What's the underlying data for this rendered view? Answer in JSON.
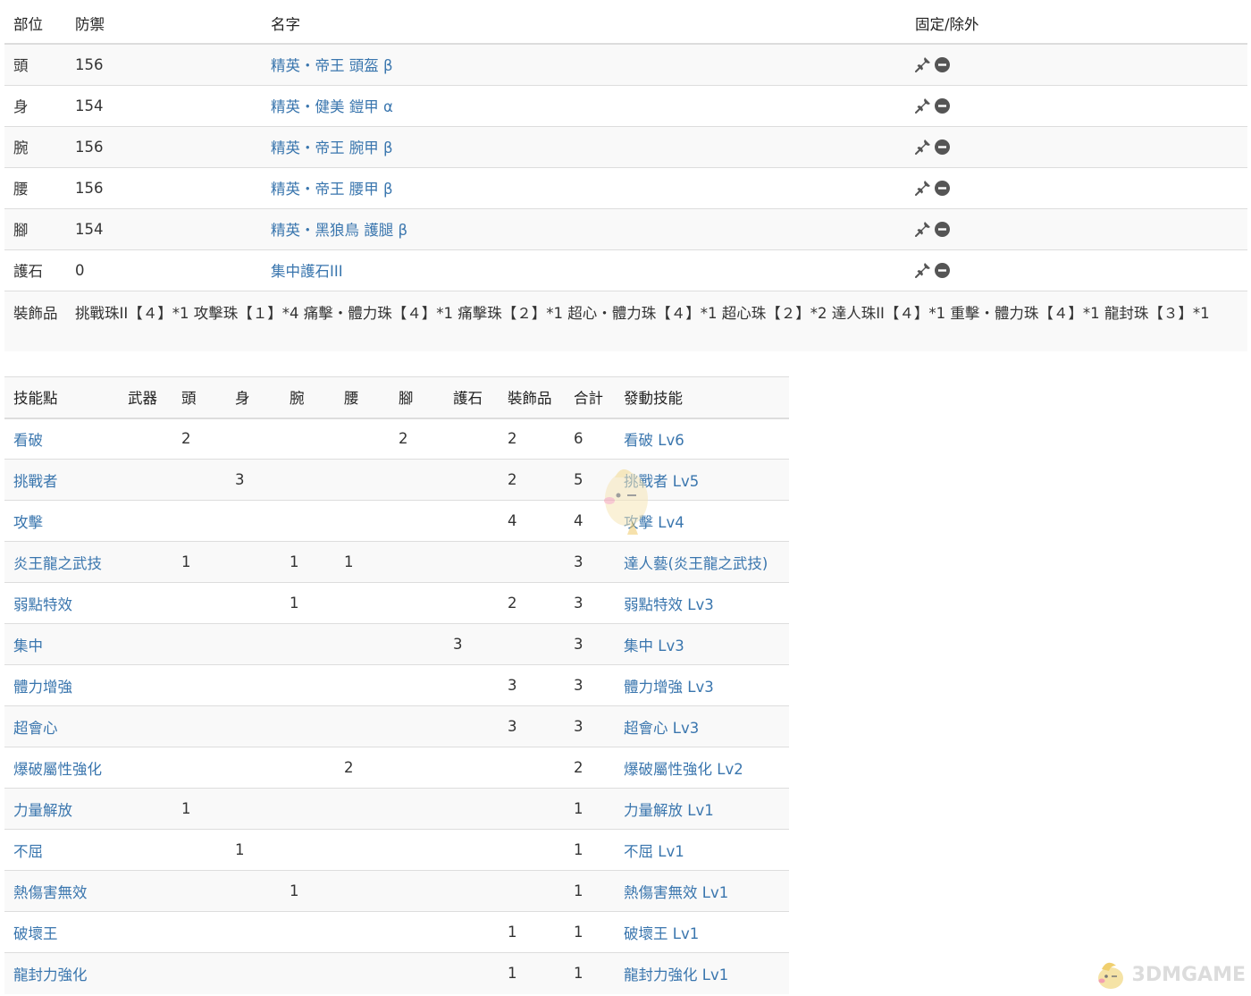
{
  "armor": {
    "headers": {
      "part": "部位",
      "defense": "防禦",
      "name": "名字",
      "actions": "固定/除外"
    },
    "rows": [
      {
        "part": "頭",
        "defense": "156",
        "name": "精英・帝王 頭盔 β"
      },
      {
        "part": "身",
        "defense": "154",
        "name": "精英・健美 鎧甲 α"
      },
      {
        "part": "腕",
        "defense": "156",
        "name": "精英・帝王 腕甲 β"
      },
      {
        "part": "腰",
        "defense": "156",
        "name": "精英・帝王 腰甲 β"
      },
      {
        "part": "腳",
        "defense": "154",
        "name": "精英・黑狼鳥 護腿 β"
      },
      {
        "part": "護石",
        "defense": "0",
        "name": "集中護石III"
      }
    ],
    "decoration": {
      "label": "裝飾品",
      "text": "挑戰珠II【４】*1 攻擊珠【１】*4 痛擊・體力珠【４】*1 痛擊珠【２】*1 超心・體力珠【４】*1 超心珠【２】*2 達人珠II【４】*1 重擊・體力珠【４】*1 龍封珠【３】*1"
    },
    "icons": {
      "fix": "pin-icon",
      "exclude": "minus-circle-icon"
    }
  },
  "skills": {
    "headers": [
      "技能點",
      "武器",
      "頭",
      "身",
      "腕",
      "腰",
      "腳",
      "護石",
      "裝飾品",
      "合計",
      "發動技能"
    ],
    "rows": [
      {
        "name": "看破",
        "weapon": "",
        "head": "2",
        "body": "",
        "arm": "",
        "waist": "",
        "leg": "2",
        "charm": "",
        "deco": "2",
        "total": "6",
        "active": "看破 Lv6"
      },
      {
        "name": "挑戰者",
        "weapon": "",
        "head": "",
        "body": "3",
        "arm": "",
        "waist": "",
        "leg": "",
        "charm": "",
        "deco": "2",
        "total": "5",
        "active": "挑戰者 Lv5"
      },
      {
        "name": "攻擊",
        "weapon": "",
        "head": "",
        "body": "",
        "arm": "",
        "waist": "",
        "leg": "",
        "charm": "",
        "deco": "4",
        "total": "4",
        "active": "攻擊 Lv4"
      },
      {
        "name": "炎王龍之武技",
        "weapon": "",
        "head": "1",
        "body": "",
        "arm": "1",
        "waist": "1",
        "leg": "",
        "charm": "",
        "deco": "",
        "total": "3",
        "active": "達人藝(炎王龍之武技)"
      },
      {
        "name": "弱點特效",
        "weapon": "",
        "head": "",
        "body": "",
        "arm": "1",
        "waist": "",
        "leg": "",
        "charm": "",
        "deco": "2",
        "total": "3",
        "active": "弱點特效 Lv3"
      },
      {
        "name": "集中",
        "weapon": "",
        "head": "",
        "body": "",
        "arm": "",
        "waist": "",
        "leg": "",
        "charm": "3",
        "deco": "",
        "total": "3",
        "active": "集中 Lv3"
      },
      {
        "name": "體力增強",
        "weapon": "",
        "head": "",
        "body": "",
        "arm": "",
        "waist": "",
        "leg": "",
        "charm": "",
        "deco": "3",
        "total": "3",
        "active": "體力增強 Lv3"
      },
      {
        "name": "超會心",
        "weapon": "",
        "head": "",
        "body": "",
        "arm": "",
        "waist": "",
        "leg": "",
        "charm": "",
        "deco": "3",
        "total": "3",
        "active": "超會心 Lv3"
      },
      {
        "name": "爆破屬性強化",
        "weapon": "",
        "head": "",
        "body": "",
        "arm": "",
        "waist": "2",
        "leg": "",
        "charm": "",
        "deco": "",
        "total": "2",
        "active": "爆破屬性強化 Lv2"
      },
      {
        "name": "力量解放",
        "weapon": "",
        "head": "1",
        "body": "",
        "arm": "",
        "waist": "",
        "leg": "",
        "charm": "",
        "deco": "",
        "total": "1",
        "active": "力量解放 Lv1"
      },
      {
        "name": "不屈",
        "weapon": "",
        "head": "",
        "body": "1",
        "arm": "",
        "waist": "",
        "leg": "",
        "charm": "",
        "deco": "",
        "total": "1",
        "active": "不屈 Lv1"
      },
      {
        "name": "熱傷害無效",
        "weapon": "",
        "head": "",
        "body": "",
        "arm": "1",
        "waist": "",
        "leg": "",
        "charm": "",
        "deco": "",
        "total": "1",
        "active": "熱傷害無效 Lv1"
      },
      {
        "name": "破壞王",
        "weapon": "",
        "head": "",
        "body": "",
        "arm": "",
        "waist": "",
        "leg": "",
        "charm": "",
        "deco": "1",
        "total": "1",
        "active": "破壞王 Lv1"
      },
      {
        "name": "龍封力強化",
        "weapon": "",
        "head": "",
        "body": "",
        "arm": "",
        "waist": "",
        "leg": "",
        "charm": "",
        "deco": "1",
        "total": "1",
        "active": "龍封力強化 Lv1"
      }
    ]
  },
  "watermark": {
    "text": "3DMGAME"
  },
  "colors": {
    "link": "#3a76ae",
    "text": "#333333",
    "stripe": "#f9f9f9",
    "border": "#dddddd",
    "icon": "#555555"
  }
}
